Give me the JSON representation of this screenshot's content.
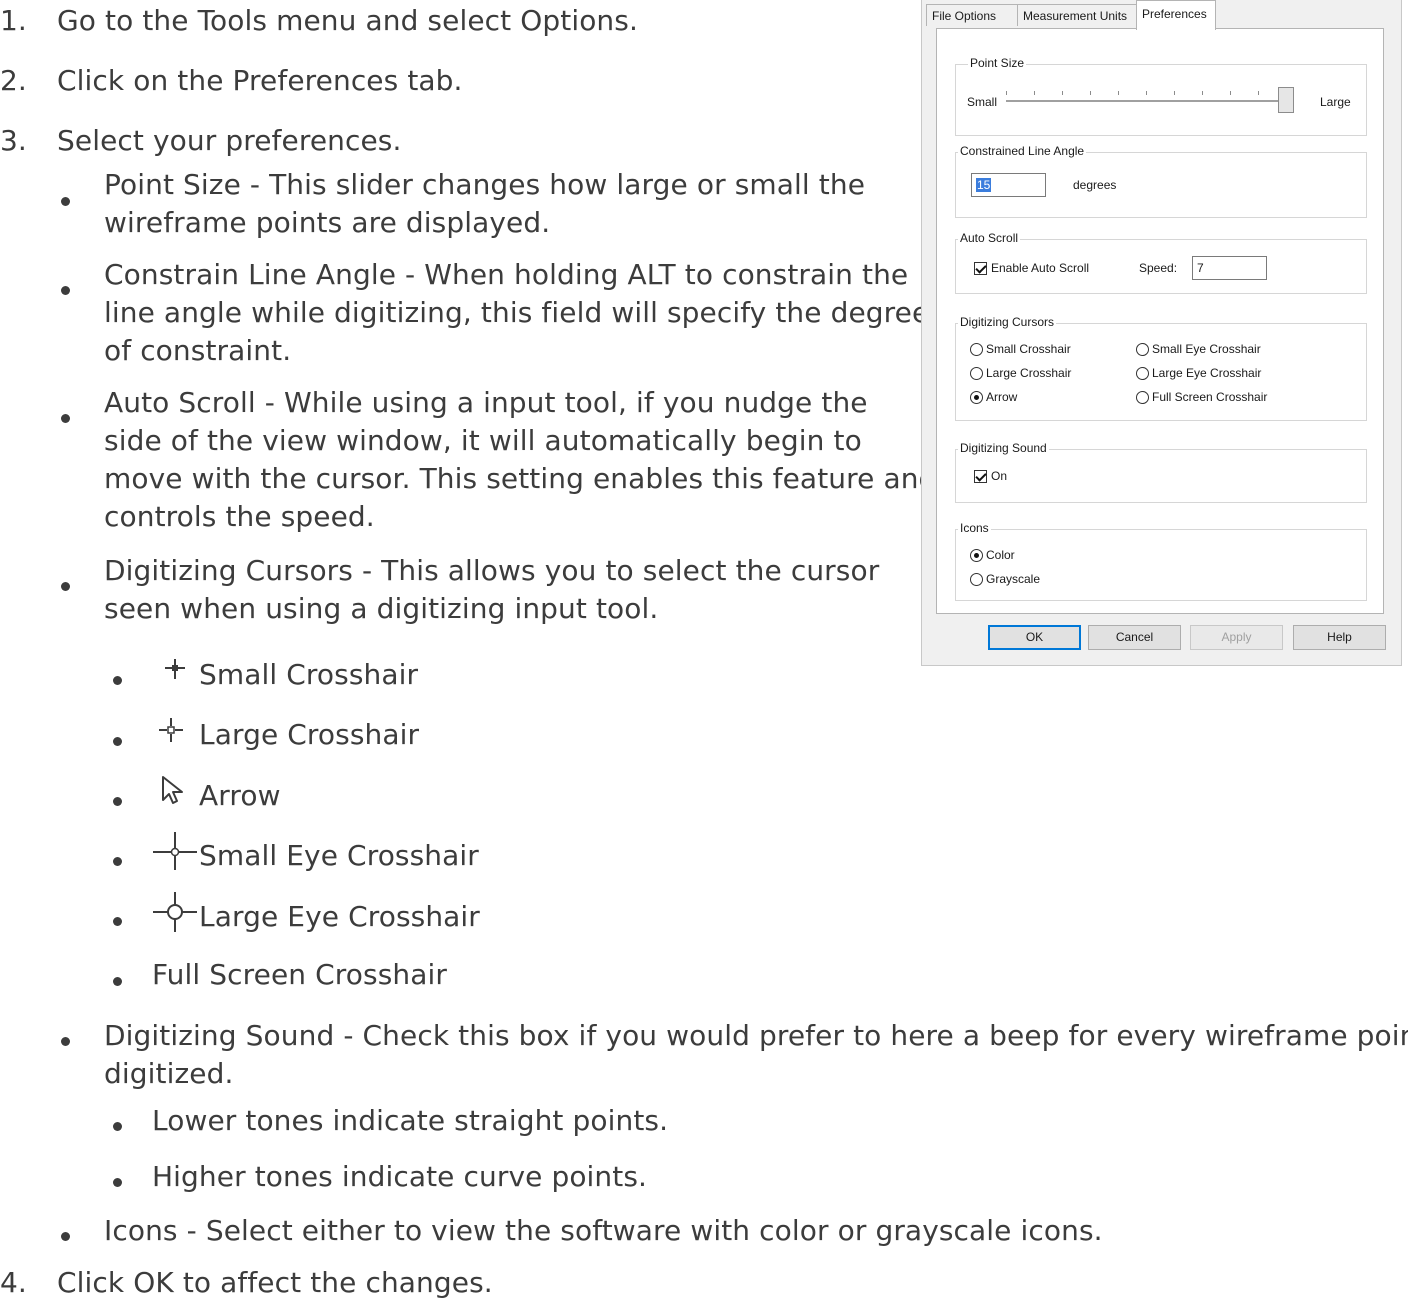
{
  "steps": [
    {
      "num": "1.",
      "text": "Go to the Tools menu and select Options."
    },
    {
      "num": "2.",
      "text": "Click on the Preferences tab."
    },
    {
      "num": "3.",
      "text": "Select your preferences."
    },
    {
      "num": "4.",
      "text": "Click OK to affect the changes."
    }
  ],
  "bullets": {
    "point_size": [
      "Point Size - This slider changes how large or small the",
      "wireframe points are displayed."
    ],
    "constrain": [
      "Constrain Line Angle - When holding ALT to constrain the",
      "line angle while digitizing, this field will specify the degree",
      "of constraint."
    ],
    "auto_scroll": [
      "Auto Scroll - While using a input tool, if you nudge the",
      "side of the view window, it will automatically begin to",
      "move with the cursor. This setting enables this feature and",
      "controls the speed."
    ],
    "cursors": [
      "Digitizing Cursors - This allows you to select the cursor",
      "seen when using a digitizing input tool."
    ],
    "cursor_items": [
      "Small Crosshair",
      "Large Crosshair",
      "Arrow",
      "Small Eye Crosshair",
      "Large Eye Crosshair",
      "Full Screen Crosshair"
    ],
    "sound": [
      "Digitizing Sound - Check this box if you would prefer to here a beep for every wireframe point",
      "digitized."
    ],
    "sound_items": [
      "Lower tones indicate straight points.",
      "Higher tones indicate curve points."
    ],
    "icons": [
      "Icons - Select either to view the software with color or grayscale icons."
    ]
  },
  "dialog": {
    "tabs": [
      "File Options",
      "Measurement Units",
      "Preferences"
    ],
    "active_tab": "Preferences",
    "point_size": {
      "legend": "Point Size",
      "min_label": "Small",
      "max_label": "Large",
      "value_fraction": 1.0
    },
    "constrained": {
      "legend": "Constrained Line Angle",
      "value": "15",
      "unit": "degrees"
    },
    "auto_scroll": {
      "legend": "Auto Scroll",
      "enable_label": "Enable Auto Scroll",
      "enabled": true,
      "speed_label": "Speed:",
      "speed_value": "7"
    },
    "cursors": {
      "legend": "Digitizing Cursors",
      "options": [
        "Small Crosshair",
        "Large Crosshair",
        "Arrow",
        "Small Eye Crosshair",
        "Large Eye Crosshair",
        "Full Screen Crosshair"
      ],
      "selected": "Arrow"
    },
    "sound": {
      "legend": "Digitizing Sound",
      "on_label": "On",
      "checked": true
    },
    "icons": {
      "legend": "Icons",
      "options": [
        "Color",
        "Grayscale"
      ],
      "selected": "Color"
    },
    "buttons": {
      "ok": "OK",
      "cancel": "Cancel",
      "apply": "Apply",
      "help": "Help"
    }
  }
}
